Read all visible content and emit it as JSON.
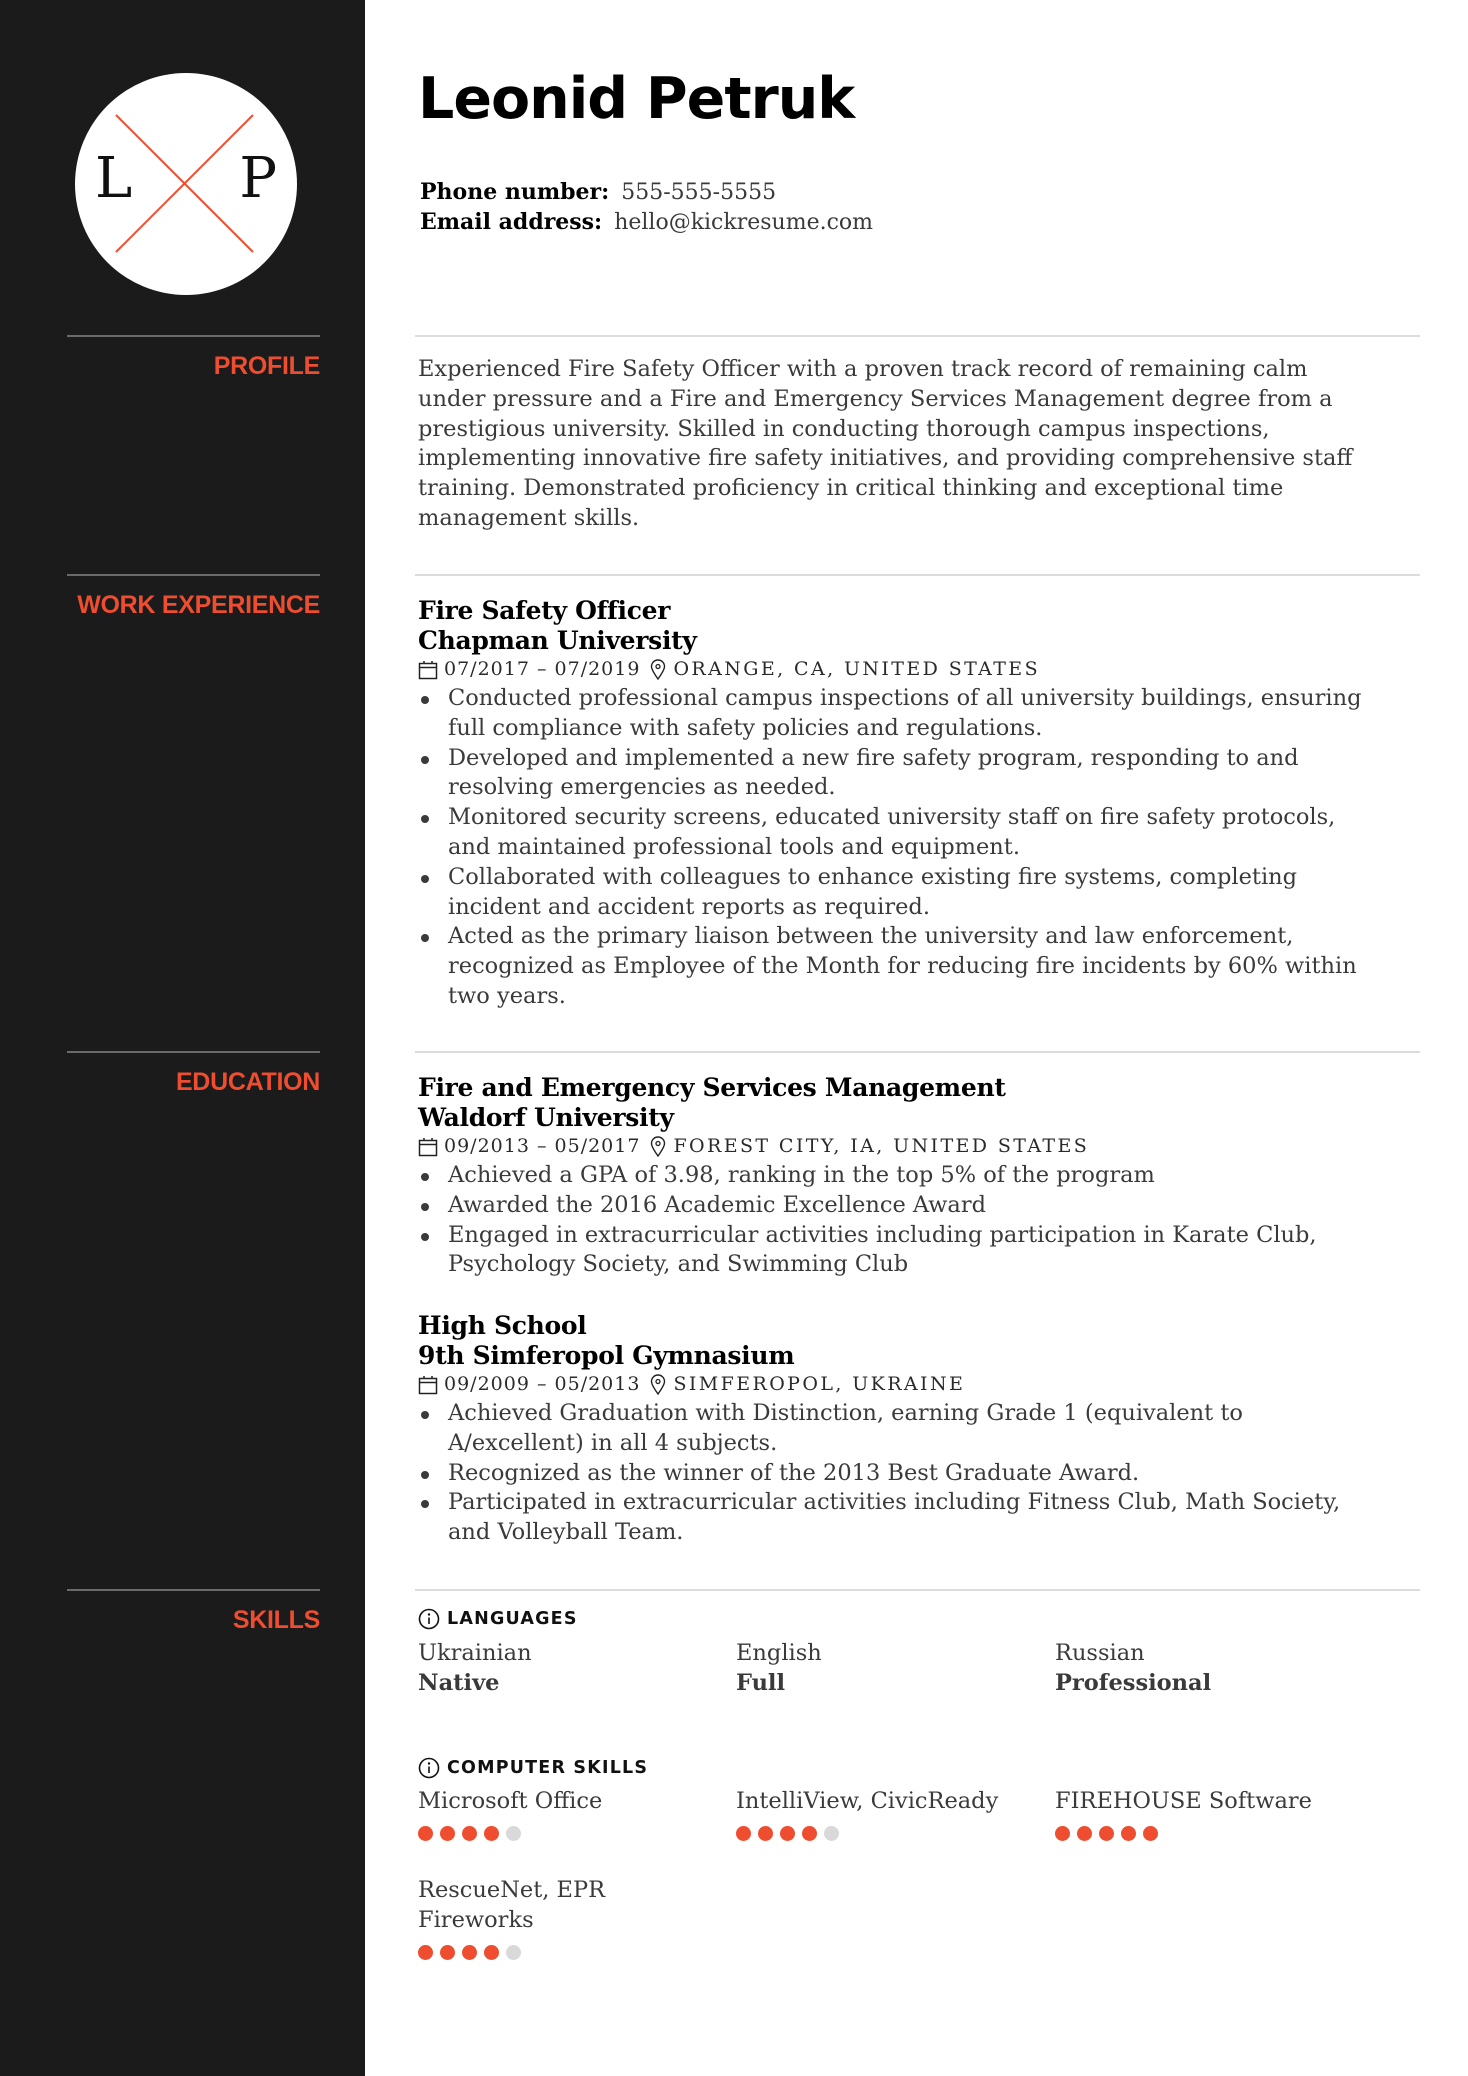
{
  "monogram": {
    "left": "L",
    "right": "P"
  },
  "colors": {
    "accent": "#ee4d30",
    "sidebar": "#1b1b1b",
    "rule": "#dcdcdc",
    "dot_empty": "#d9d9d9"
  },
  "header": {
    "name": "Leonid Petruk",
    "phone_label": "Phone number:",
    "phone": "555-555-5555",
    "email_label": "Email address:",
    "email": "hello@kickresume.com"
  },
  "sections": {
    "profile": "PROFILE",
    "work": "WORK EXPERIENCE",
    "education": "EDUCATION",
    "skills": "SKILLS"
  },
  "profile": {
    "text": "Experienced Fire Safety Officer with a proven track record of remaining calm under pressure and a Fire and Emergency Services Management degree from a prestigious university. Skilled in conducting thorough campus inspections, implementing innovative fire safety initiatives, and providing comprehensive staff training. Demonstrated proficiency in critical thinking and exceptional time management skills."
  },
  "work": [
    {
      "title": "Fire Safety Officer",
      "organization": "Chapman University",
      "dates": "07/2017 – 07/2019",
      "location": "ORANGE, CA, UNITED STATES",
      "bullets": [
        "Conducted professional campus inspections of all university buildings, ensuring full compliance with safety policies and regulations.",
        "Developed and implemented a new fire safety program, responding to and resolving emergencies as needed.",
        "Monitored security screens, educated university staff on fire safety protocols, and maintained professional tools and equipment.",
        "Collaborated with colleagues to enhance existing fire systems, completing incident and accident reports as required.",
        "Acted as the primary liaison between the university and law enforcement, recognized as Employee of the Month for reducing fire incidents by 60% within two years."
      ]
    }
  ],
  "education": [
    {
      "title": "Fire and Emergency Services Management",
      "organization": "Waldorf University",
      "dates": "09/2013 – 05/2017",
      "location": "FOREST CITY, IA, UNITED STATES",
      "bullets": [
        "Achieved a GPA of 3.98, ranking in the top 5% of the program",
        "Awarded the 2016 Academic Excellence Award",
        "Engaged in extracurricular activities including participation in Karate Club, Psychology Society, and Swimming Club"
      ]
    },
    {
      "title": "High School",
      "organization": "9th Simferopol Gymnasium",
      "dates": "09/2009 – 05/2013",
      "location": "SIMFEROPOL, UKRAINE",
      "bullets": [
        "Achieved Graduation with Distinction, earning Grade 1 (equivalent to A/excellent) in all 4 subjects.",
        "Recognized as the winner of the 2013 Best Graduate Award.",
        "Participated in extracurricular activities including Fitness Club, Math Society, and Volleyball Team."
      ]
    }
  ],
  "skills": {
    "languages_label": "LANGUAGES",
    "languages": [
      {
        "name": "Ukrainian",
        "level": "Native"
      },
      {
        "name": "English",
        "level": "Full"
      },
      {
        "name": "Russian",
        "level": "Professional"
      }
    ],
    "computer_label": "COMPUTER SKILLS",
    "computer": [
      {
        "name": "Microsoft Office",
        "rating": 4,
        "max": 5
      },
      {
        "name": "IntelliView, CivicReady",
        "rating": 4,
        "max": 5
      },
      {
        "name": "FIREHOUSE Software",
        "rating": 5,
        "max": 5
      },
      {
        "name": "RescueNet, EPR Fireworks",
        "rating": 4,
        "max": 5
      }
    ]
  }
}
